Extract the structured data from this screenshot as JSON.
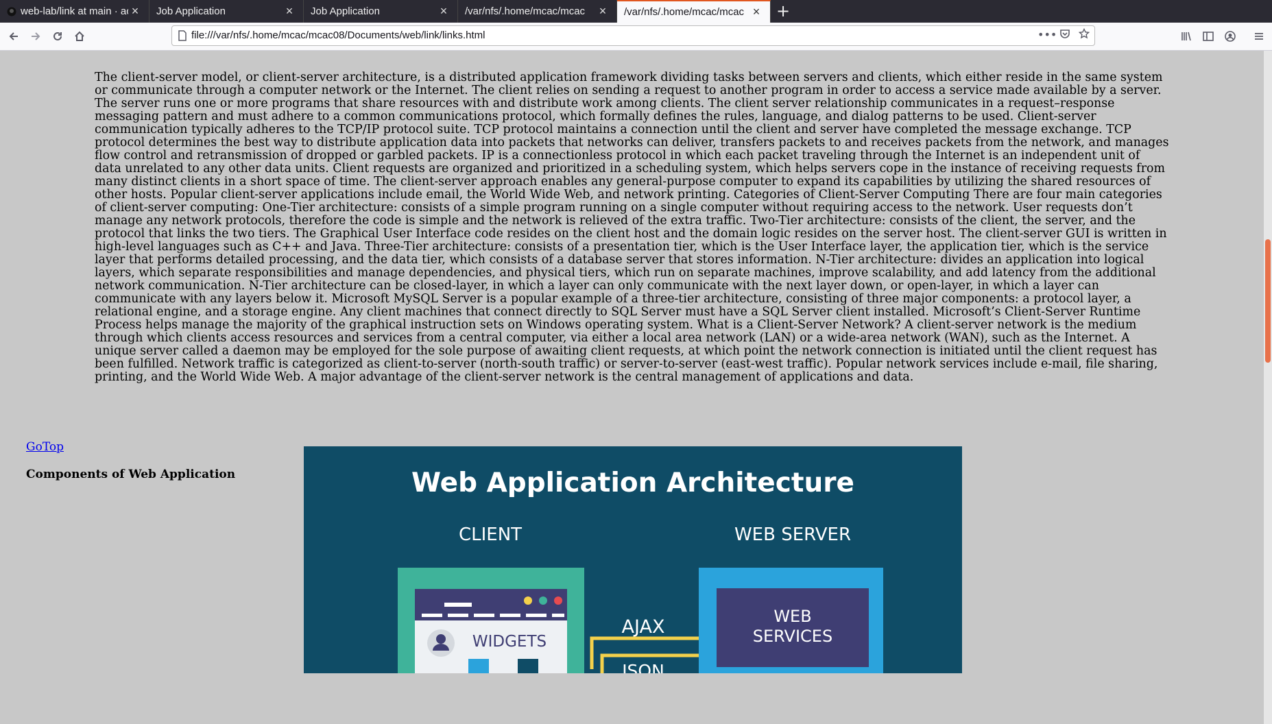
{
  "tabs": [
    {
      "label": "web-lab/link at main · ac",
      "icon": "github-icon",
      "active": false
    },
    {
      "label": "Job Application",
      "icon": "",
      "active": false
    },
    {
      "label": "Job Application",
      "icon": "",
      "active": false
    },
    {
      "label": "/var/nfs/.home/mcac/mcac",
      "icon": "",
      "active": false
    },
    {
      "label": "/var/nfs/.home/mcac/mcac",
      "icon": "",
      "active": true
    }
  ],
  "toolbar": {
    "url": "file:///var/nfs/.home/mcac/mcac08/Documents/web/link/links.html"
  },
  "content": {
    "paragraph": "The client-server model, or client-server architecture, is a distributed application framework dividing tasks between servers and clients, which either reside in the same system or communicate through a computer network or the Internet. The client relies on sending a request to another program in order to access a service made available by a server. The server runs one or more programs that share resources with and distribute work among clients. The client server relationship communicates in a request–response messaging pattern and must adhere to a common communications protocol, which formally defines the rules, language, and dialog patterns to be used. Client-server communication typically adheres to the TCP/IP protocol suite. TCP protocol maintains a connection until the client and server have completed the message exchange. TCP protocol determines the best way to distribute application data into packets that networks can deliver, transfers packets to and receives packets from the network, and manages flow control and retransmission of dropped or garbled packets. IP is a connectionless protocol in which each packet traveling through the Internet is an independent unit of data unrelated to any other data units. Client requests are organized and prioritized in a scheduling system, which helps servers cope in the instance of receiving requests from many distinct clients in a short space of time. The client-server approach enables any general-purpose computer to expand its capabilities by utilizing the shared resources of other hosts. Popular client-server applications include email, the World Wide Web, and network printing.  Categories of Client-Server Computing There are four main categories of client-server computing: One-Tier architecture: consists of a simple program running on a single computer without requiring access to the network. User requests don’t manage any network protocols, therefore the code is simple and the network is relieved of the extra traffic. Two-Tier architecture: consists of the client, the server, and the protocol that links the two tiers. The Graphical User Interface code resides on the client host and the domain logic resides on the server host. The client-server GUI is written in high-level languages such as C++ and Java. Three-Tier architecture: consists of a presentation tier, which is the User Interface layer, the application tier, which is the service layer that performs detailed processing, and the data tier, which consists of a database server that stores information. N-Tier architecture: divides an application into logical layers, which separate responsibilities and manage dependencies, and physical tiers, which run on separate machines, improve scalability, and add latency from the additional network communication. N-Tier architecture can be closed-layer, in which a layer can only communicate with the next layer down, or open-layer, in which a layer can communicate with any layers below it. Microsoft MySQL Server is a popular example of a three-tier architecture, consisting of three major components: a protocol layer, a relational engine, and a storage engine. Any client machines that connect directly to SQL Server must have a SQL Server client installed. Microsoft’s Client-Server Runtime Process helps manage the majority of the graphical instruction sets on Windows operating system.  What is a Client-Server Network? A client-server network is the medium through which clients access resources and services from a central computer, via either a local area network (LAN) or a wide-area network (WAN), such as the Internet. A unique server called a daemon may be employed for the sole purpose of awaiting client requests, at which point the network connection is initiated until the client request has been fulfilled. Network traffic is categorized as client-to-server (north-south traffic) or server-to-server (east-west traffic). Popular network services include e-mail, file sharing, printing, and the World Wide Web. A major advantage of the client-server network is the central management of applications and data.",
    "gotop_link": "GoTop",
    "heading": "Components of Web Application",
    "image": {
      "title": "Web Application Architecture",
      "client_label": "CLIENT",
      "server_label": "WEB SERVER",
      "widgets_label": "WIDGETS",
      "ajax_label": "AJAX",
      "json_label": "JSON",
      "web_services_line1": "WEB",
      "web_services_line2": "SERVICES"
    }
  },
  "colors": {
    "page_bg": "#c8c8c8",
    "image_bg": "#0f4c66",
    "client_panel": "#3fb39a",
    "server_panel": "#2ba3dc",
    "web_services_box": "#3f3e73",
    "arrow": "#f4d14b",
    "scroll_thumb": "#e8714a"
  }
}
